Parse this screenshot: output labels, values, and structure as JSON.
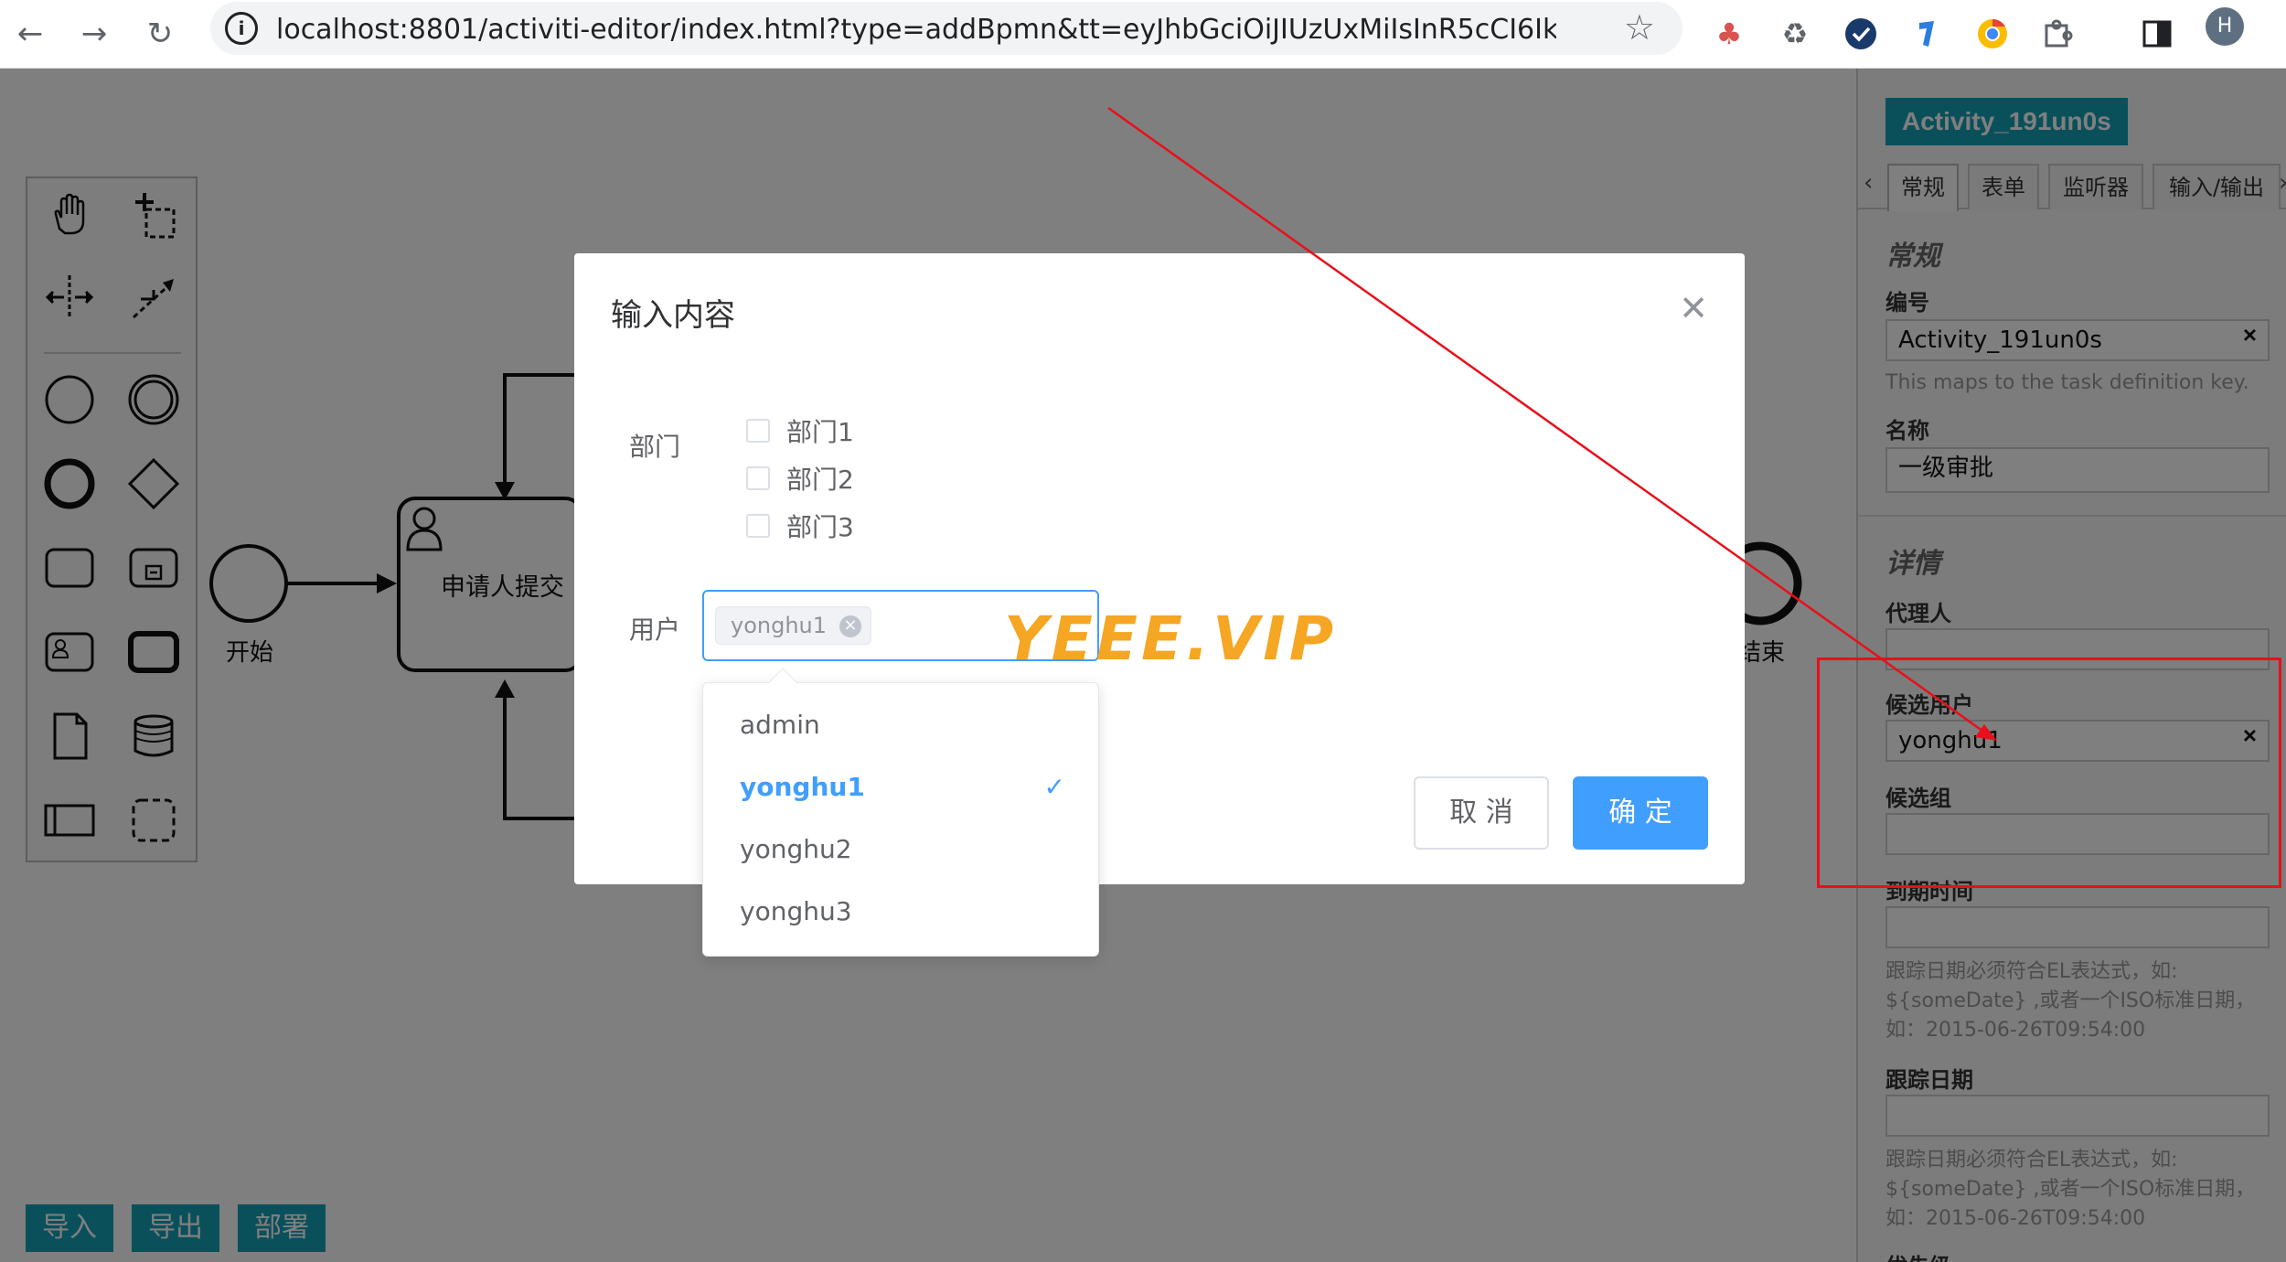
{
  "browser": {
    "url": "localhost:8801/activiti-editor/index.html?type=addBpmn&tt=eyJhbGciOiJIUzUxMiIsInR5cCI6IkpXVCJ9.eyJz...",
    "profile_initial": "H"
  },
  "diagram": {
    "start_label": "开始",
    "task_label": "申请人提交",
    "end_label": "结束"
  },
  "bottom_buttons": {
    "import": "导入",
    "export": "导出",
    "deploy": "部署"
  },
  "panel": {
    "title": "Activity_191un0s",
    "tabs": [
      "常规",
      "表单",
      "监听器",
      "输入/输出"
    ],
    "general": {
      "group_title": "常规",
      "id_label": "编号",
      "id_value": "Activity_191un0s",
      "id_hint": "This maps to the task definition key.",
      "name_label": "名称",
      "name_value": "一级审批"
    },
    "details": {
      "group_title": "详情",
      "assignee_label": "代理人",
      "candidate_users_label": "候选用户",
      "candidate_users_value": "yonghu1",
      "candidate_groups_label": "候选组",
      "due_date_label": "到期时间",
      "due_date_hint": "跟踪日期必须符合EL表达式，如: ${someDate} ,或者一个ISO标准日期，如：2015-06-26T09:54:00",
      "follow_up_label": "跟踪日期",
      "follow_up_hint": "跟踪日期必须符合EL表达式，如: ${someDate} ,或者一个ISO标准日期，如：2015-06-26T09:54:00",
      "priority_label": "优先级"
    }
  },
  "dialog": {
    "title": "输入内容",
    "dept_label": "部门",
    "departments": [
      "部门1",
      "部门2",
      "部门3"
    ],
    "user_label": "用户",
    "selected_tag": "yonghu1",
    "cancel": "取 消",
    "confirm": "确 定"
  },
  "dropdown": {
    "options": [
      "admin",
      "yonghu1",
      "yonghu2",
      "yonghu3"
    ],
    "selected": "yonghu1"
  },
  "watermark": "YEEE.VIP",
  "colors": {
    "accent": "#409eff",
    "teal": "#12a1b7",
    "annotation": "#e8101a",
    "watermark": "#f5a623"
  }
}
